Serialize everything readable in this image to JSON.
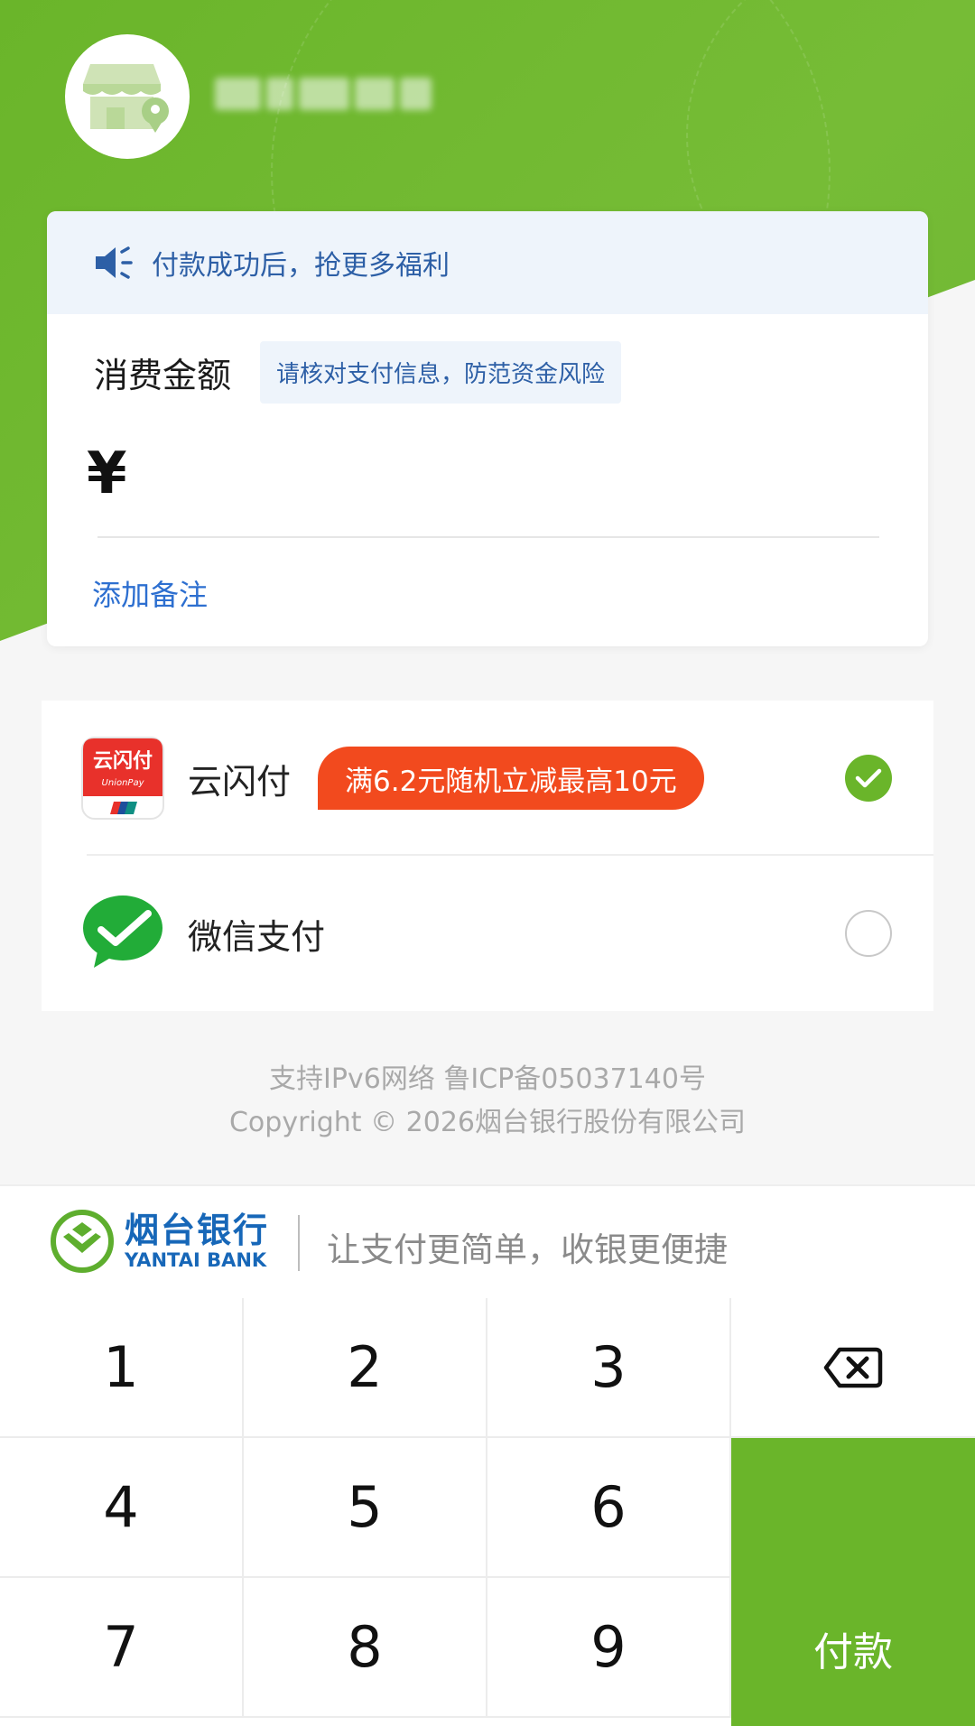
{
  "merchant": {
    "icon": "store-location-icon"
  },
  "notice": {
    "icon": "speaker-icon",
    "text": "付款成功后，抢更多福利"
  },
  "amount": {
    "label": "消费金额",
    "risk_tip": "请核对支付信息，防范资金风险",
    "currency": "¥",
    "value": "",
    "add_remark": "添加备注"
  },
  "payment_methods": [
    {
      "name": "云闪付",
      "icon": "unionpay-quickpass-icon",
      "promo": "满6.2元随机立减最高10元",
      "selected": true
    },
    {
      "name": "微信支付",
      "icon": "wechat-pay-icon",
      "promo": "",
      "selected": false
    }
  ],
  "footer": {
    "line1": "支持IPv6网络 鲁ICP备05037140号",
    "line2": "Copyright © 2026烟台银行股份有限公司"
  },
  "bank": {
    "name_cn": "烟台银行",
    "name_en": "YANTAI BANK",
    "slogan": "让支付更简单，收银更便捷"
  },
  "keypad": {
    "keys": [
      "1",
      "2",
      "3",
      "4",
      "5",
      "6",
      "7",
      "8",
      "9"
    ],
    "backspace_icon": "backspace-icon",
    "pay_label": "付款"
  },
  "colors": {
    "brand_green": "#6ab52a",
    "link_blue": "#2d6fd0",
    "promo_red": "#f24a1e",
    "bank_blue": "#1767b8"
  }
}
